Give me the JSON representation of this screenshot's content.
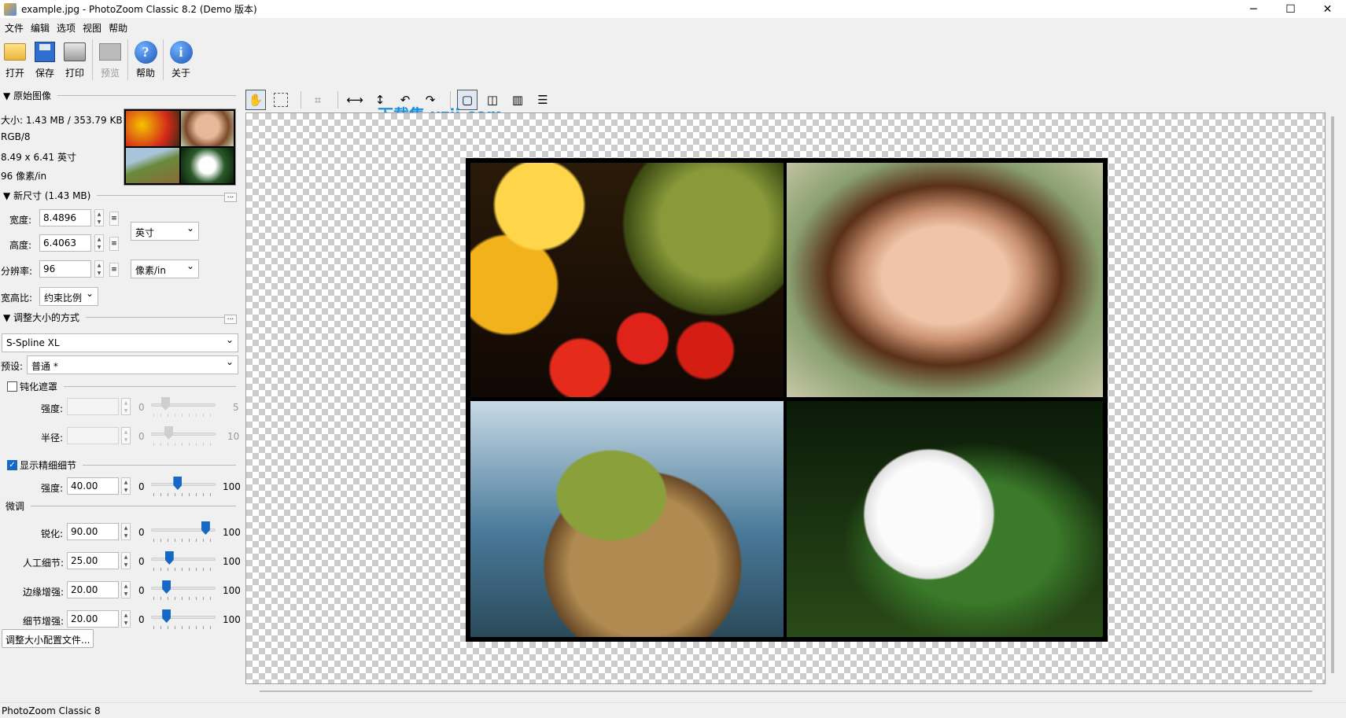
{
  "window": {
    "title": "example.jpg - PhotoZoom Classic 8.2 (Demo 版本)"
  },
  "menu": [
    "文件",
    "编辑",
    "选项",
    "视图",
    "帮助"
  ],
  "toolbar": {
    "open": "打开",
    "save": "保存",
    "print": "打印",
    "preview": "预览",
    "help": "帮助",
    "about": "关于"
  },
  "original": {
    "heading": "原始图像",
    "size": "大小: 1.43 MB / 353.79 KB",
    "mode": "RGB/8",
    "dims": "8.49 x 6.41 英寸",
    "res": "96 像素/in"
  },
  "newsize": {
    "heading": "新尺寸 (1.43 MB)",
    "width_label": "宽度:",
    "width": "8.4896",
    "height_label": "高度:",
    "height": "6.4063",
    "res_label": "分辨率:",
    "res": "96",
    "unit": "英寸",
    "res_unit": "像素/in",
    "aspect_label": "宽高比:",
    "aspect": "约束比例"
  },
  "method": {
    "heading": "调整大小的方式",
    "algo": "S-Spline XL",
    "preset_label": "预设:",
    "preset": "普通 *",
    "unsharp": "钝化遮罩",
    "strength_label": "强度:",
    "strength_min": "0",
    "strength_max": "5",
    "radius_label": "半径:",
    "radius_min": "0",
    "radius_max": "10",
    "fine": "显示精细细节",
    "fine_strength_label": "强度:",
    "fine_strength": "40.00",
    "fine_min": "0",
    "fine_max": "100",
    "fine_level": 40,
    "tune": "微调",
    "sharpen_label": "锐化:",
    "sharpen": "90.00",
    "sharpen_level": 90,
    "artificial_label": "人工细节:",
    "artificial": "25.00",
    "artificial_level": 25,
    "edge_label": "边缘增强:",
    "edge": "20.00",
    "edge_level": 20,
    "detail_label": "细节增强:",
    "detail": "20.00",
    "detail_level": 20,
    "min": "0",
    "max": "100",
    "profile_button": "调整大小配置文件..."
  },
  "watermark": "下载集 xzji.com",
  "status": "PhotoZoom Classic 8",
  "colors": {
    "accent": "#1668c7"
  }
}
